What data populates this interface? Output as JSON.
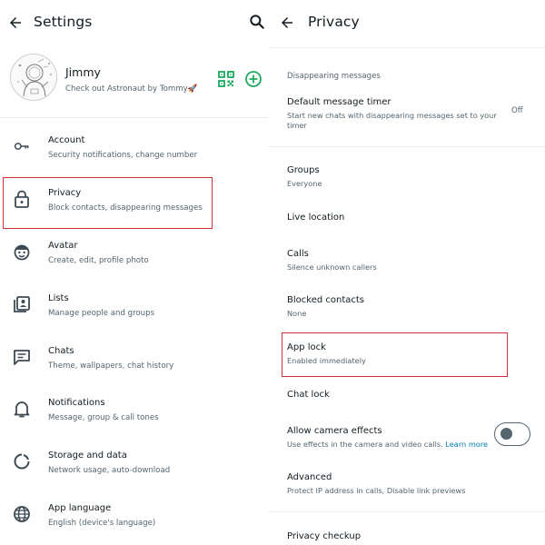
{
  "settings": {
    "title": "Settings",
    "profile": {
      "name": "Jimmy",
      "about": "Check out Astronaut by Tommy🚀"
    },
    "items": [
      {
        "label": "Account",
        "sub": "Security notifications, change number",
        "icon": "key-icon"
      },
      {
        "label": "Privacy",
        "sub": "Block contacts, disappearing messages",
        "icon": "lock-icon"
      },
      {
        "label": "Avatar",
        "sub": "Create, edit, profile photo",
        "icon": "avatar-face-icon"
      },
      {
        "label": "Lists",
        "sub": "Manage people and groups",
        "icon": "contacts-list-icon"
      },
      {
        "label": "Chats",
        "sub": "Theme, wallpapers, chat history",
        "icon": "chat-icon"
      },
      {
        "label": "Notifications",
        "sub": "Message, group & call tones",
        "icon": "bell-icon"
      },
      {
        "label": "Storage and data",
        "sub": "Network usage, auto-download",
        "icon": "storage-circle-icon"
      },
      {
        "label": "App language",
        "sub": "English (device's language)",
        "icon": "globe-icon"
      }
    ]
  },
  "privacy": {
    "title": "Privacy",
    "section_disappearing": "Disappearing messages",
    "default_timer": {
      "label": "Default message timer",
      "sub": "Start new chats with disappearing messages set to your timer",
      "value": "Off"
    },
    "groups": {
      "label": "Groups",
      "sub": "Everyone"
    },
    "live_location": {
      "label": "Live location"
    },
    "calls": {
      "label": "Calls",
      "sub": "Silence unknown callers"
    },
    "blocked": {
      "label": "Blocked contacts",
      "sub": "None"
    },
    "app_lock": {
      "label": "App lock",
      "sub": "Enabled immediately"
    },
    "chat_lock": {
      "label": "Chat lock"
    },
    "camera_effects": {
      "label": "Allow camera effects",
      "sub": "Use effects in the camera and video calls.",
      "link": "Learn more",
      "enabled": false
    },
    "advanced": {
      "label": "Advanced",
      "sub": "Protect IP address in calls, Disable link previews"
    },
    "privacy_checkup": {
      "label": "Privacy checkup"
    }
  },
  "colors": {
    "accent_green": "#1daa61",
    "highlight_red": "#d32f2f",
    "text_primary": "#111b21",
    "text_secondary": "#54656f"
  }
}
